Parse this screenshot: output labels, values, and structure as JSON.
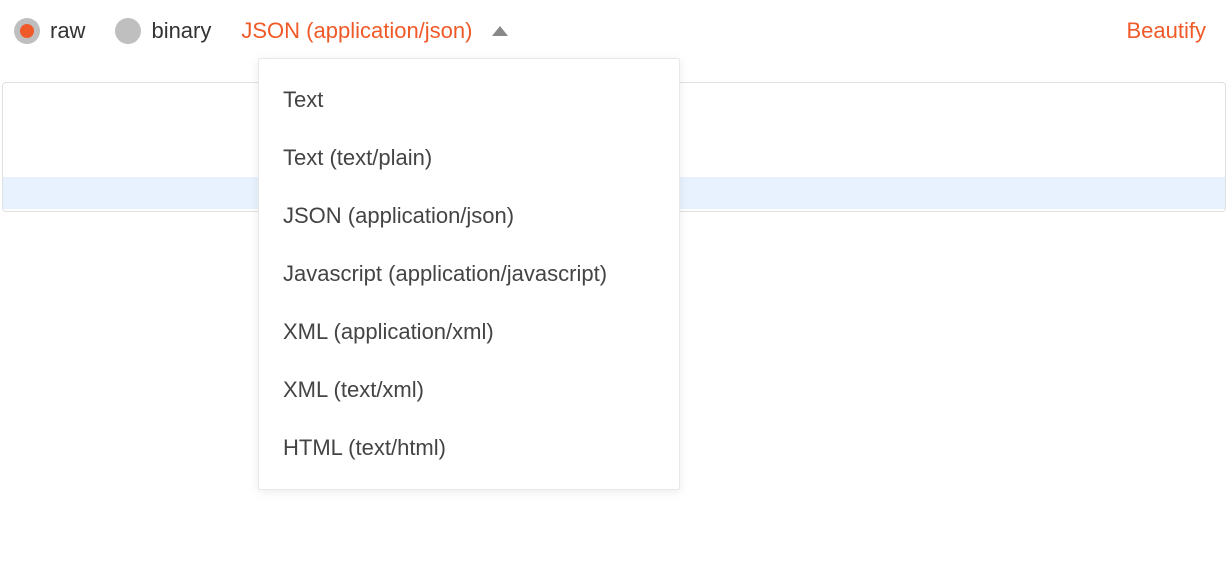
{
  "toolbar": {
    "radio_raw": "raw",
    "radio_binary": "binary",
    "content_type_selected": "JSON (application/json)",
    "beautify_label": "Beautify"
  },
  "dropdown": {
    "options": [
      "Text",
      "Text (text/plain)",
      "JSON (application/json)",
      "Javascript (application/javascript)",
      "XML (application/xml)",
      "XML (text/xml)",
      "HTML (text/html)"
    ]
  }
}
